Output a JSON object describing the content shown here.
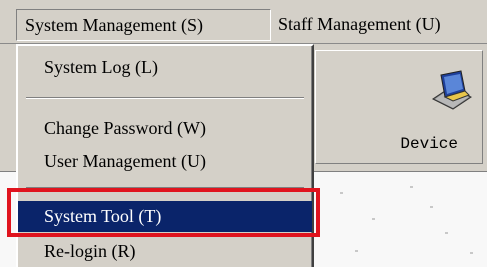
{
  "menubar": {
    "system_management": "System Management (S)",
    "staff_management": "Staff Management (U)"
  },
  "dropdown": {
    "items": [
      {
        "label": "System Log (L)"
      },
      {
        "label": "Change Password (W)"
      },
      {
        "label": "User Management (U)"
      },
      {
        "label": "System Tool (T)",
        "selected": true
      },
      {
        "label": "Re-login (R)"
      }
    ]
  },
  "toolbar": {
    "device_label": "Device",
    "device_icon": "laptop-icon"
  },
  "colors": {
    "menu_bg": "#d4d0c8",
    "selection_bg": "#0a246a",
    "highlight_frame": "#e0141e"
  }
}
